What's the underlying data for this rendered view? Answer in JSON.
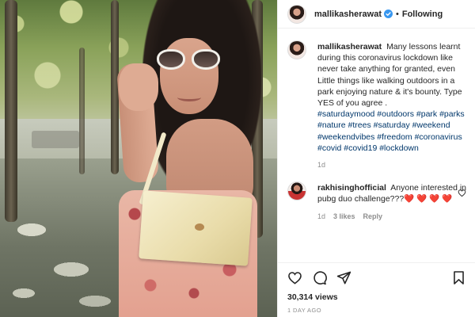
{
  "header": {
    "username": "mallikasherawat",
    "separator": "•",
    "follow_status": "Following"
  },
  "caption": {
    "username": "mallikasherawat",
    "text": "Many lessons learnt during this coronavirus lockdown like never take anything for granted, even Little things like walking outdoors in a park enjoying nature & it's bounty. Type YES of you agree .",
    "hashtags": "#saturdaymood #outdoors #park #parks #nature #trees #saturday #weekend #weekendvibes #freedom #coronavirus #covid #covid19 #lockdown",
    "time": "1d"
  },
  "comment": {
    "username": "rakhisinghofficial",
    "text": "Anyone interested in pubg duo challenge???❤️ ❤️ ❤️ ❤️",
    "time": "1d",
    "likes": "3 likes",
    "reply": "Reply"
  },
  "footer": {
    "views": "30,314 views",
    "posted": "1 DAY AGO"
  },
  "colors": {
    "text": "#262626",
    "muted": "#8e8e8e",
    "hashtag": "#00376b",
    "verified": "#3897f0",
    "border": "#efefef"
  },
  "icons": [
    "verified-badge-icon",
    "heart-icon",
    "comment-icon",
    "share-icon",
    "bookmark-icon",
    "like-comment-icon"
  ]
}
